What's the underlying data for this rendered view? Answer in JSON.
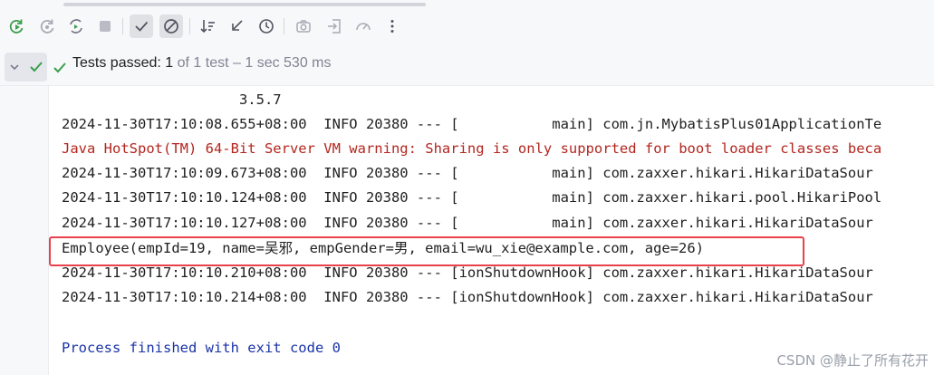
{
  "toolbar": {
    "buttons": [
      {
        "icon": "rerun-icon"
      },
      {
        "icon": "rerun-failed-icon"
      },
      {
        "icon": "toggle-auto-test-icon"
      },
      {
        "icon": "stop-icon"
      },
      {
        "icon": "show-passed-icon"
      },
      {
        "icon": "show-ignored-icon"
      },
      {
        "icon": "sort-icon"
      },
      {
        "icon": "collapse-icon"
      },
      {
        "icon": "history-icon"
      },
      {
        "icon": "camera-icon"
      },
      {
        "icon": "import-icon"
      },
      {
        "icon": "coverage-icon"
      },
      {
        "icon": "more-icon"
      }
    ]
  },
  "status": {
    "prefix": "Tests passed: ",
    "passed": "1",
    "rest": " of 1 test – 1 sec 530 ms"
  },
  "console": {
    "lines": [
      {
        "kind": "normal",
        "text": "                     3.5.7"
      },
      {
        "kind": "normal",
        "text": "2024-11-30T17:10:08.655+08:00  INFO 20380 --- [           main] com.jn.MybatisPlus01ApplicationTe"
      },
      {
        "kind": "warn",
        "text": "Java HotSpot(TM) 64-Bit Server VM warning: Sharing is only supported for boot loader classes beca"
      },
      {
        "kind": "normal",
        "text": "2024-11-30T17:10:09.673+08:00  INFO 20380 --- [           main] com.zaxxer.hikari.HikariDataSour"
      },
      {
        "kind": "normal",
        "text": "2024-11-30T17:10:10.124+08:00  INFO 20380 --- [           main] com.zaxxer.hikari.pool.HikariPool"
      },
      {
        "kind": "normal",
        "text": "2024-11-30T17:10:10.127+08:00  INFO 20380 --- [           main] com.zaxxer.hikari.HikariDataSour"
      },
      {
        "kind": "normal",
        "text": "Employee(empId=19, name=吴邪, empGender=男, email=wu_xie@example.com, age=26)"
      },
      {
        "kind": "normal",
        "text": "2024-11-30T17:10:10.210+08:00  INFO 20380 --- [ionShutdownHook] com.zaxxer.hikari.HikariDataSour"
      },
      {
        "kind": "normal",
        "text": "2024-11-30T17:10:10.214+08:00  INFO 20380 --- [ionShutdownHook] com.zaxxer.hikari.HikariDataSour"
      },
      {
        "kind": "normal",
        "text": ""
      },
      {
        "kind": "exit",
        "text": "Process finished with exit code 0"
      }
    ]
  },
  "watermark": "CSDN @静止了所有花开",
  "colors": {
    "success": "#3a9e4b",
    "warning_text": "#b3261e",
    "exit_text": "#1a33a6",
    "highlight_border": "#e9414b"
  }
}
